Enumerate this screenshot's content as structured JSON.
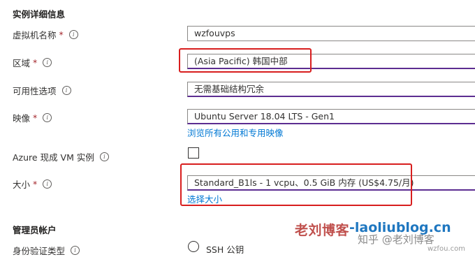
{
  "instance_details": {
    "title": "实例详细信息",
    "vm_name": {
      "label": "虚拟机名称",
      "required": "*",
      "value": "wzfouvps"
    },
    "region": {
      "label": "区域",
      "required": "*",
      "value": "(Asia Pacific) 韩国中部"
    },
    "availability": {
      "label": "可用性选项",
      "value": "无需基础结构冗余"
    },
    "image": {
      "label": "映像",
      "required": "*",
      "value": "Ubuntu Server 18.04 LTS - Gen1",
      "link": "浏览所有公用和专用映像"
    },
    "spot": {
      "label": "Azure 现成 VM 实例"
    },
    "size": {
      "label": "大小",
      "required": "*",
      "value": "Standard_B1ls - 1 vcpu、0.5 GiB 内存 (US$4.75/月)",
      "link": "选择大小"
    }
  },
  "admin_account": {
    "title": "管理员帐户",
    "auth_type": {
      "label": "身份验证类型",
      "option": "SSH 公钥"
    }
  },
  "info_icon_glyph": "i",
  "watermark": {
    "site_cn": "老刘博客",
    "site_url": "-laoliublog.cn",
    "zhihu": "知乎 @老刘博客",
    "small": "wzfou.com"
  },
  "colors": {
    "highlight": "#d81e1e",
    "link": "#0078d4",
    "required": "#a4262c",
    "select_underline": "#5c2d91"
  }
}
